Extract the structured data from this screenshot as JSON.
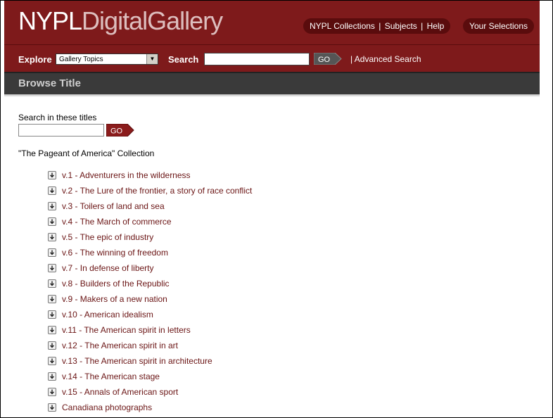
{
  "header": {
    "logo_bold": "NYPL",
    "logo_light": "DigitalGallery",
    "links": [
      "NYPL Collections",
      "Subjects",
      "Help"
    ],
    "link_sep": "|",
    "selections": "Your Selections"
  },
  "nav": {
    "explore_label": "Explore",
    "topics_selected": "Gallery Topics",
    "search_label": "Search",
    "go": "GO",
    "advanced": "| Advanced Search"
  },
  "browse": {
    "title": "Browse Title"
  },
  "content": {
    "search_label": "Search in these titles",
    "go": "GO",
    "collection_title": "\"The Pageant of America\" Collection",
    "items": [
      "v.1 - Adventurers in the wilderness",
      "v.2 - The Lure of the frontier, a story of race conflict",
      "v.3 - Toilers of land and sea",
      "v.4 - The March of commerce",
      "v.5 - The epic of industry",
      "v.6 - The winning of freedom",
      "v.7 - In defense of liberty",
      "v.8 - Builders of the Republic",
      "v.9 - Makers of a new nation",
      "v.10 - American idealism",
      "v.11 - The American spirit in letters",
      "v.12 - The American spirit in art",
      "v.13 - The American spirit in architecture",
      "v.14 - The American stage",
      "v.15 - Annals of American sport",
      "Canadiana photographs"
    ]
  },
  "colors": {
    "brand": "#7e1a1b",
    "dark_pill": "#5a0c0d",
    "bar": "#3a3a3a",
    "link": "#6a1414"
  },
  "icons": {
    "expand": "expand-arrow-icon",
    "go": "go-arrow-icon"
  }
}
